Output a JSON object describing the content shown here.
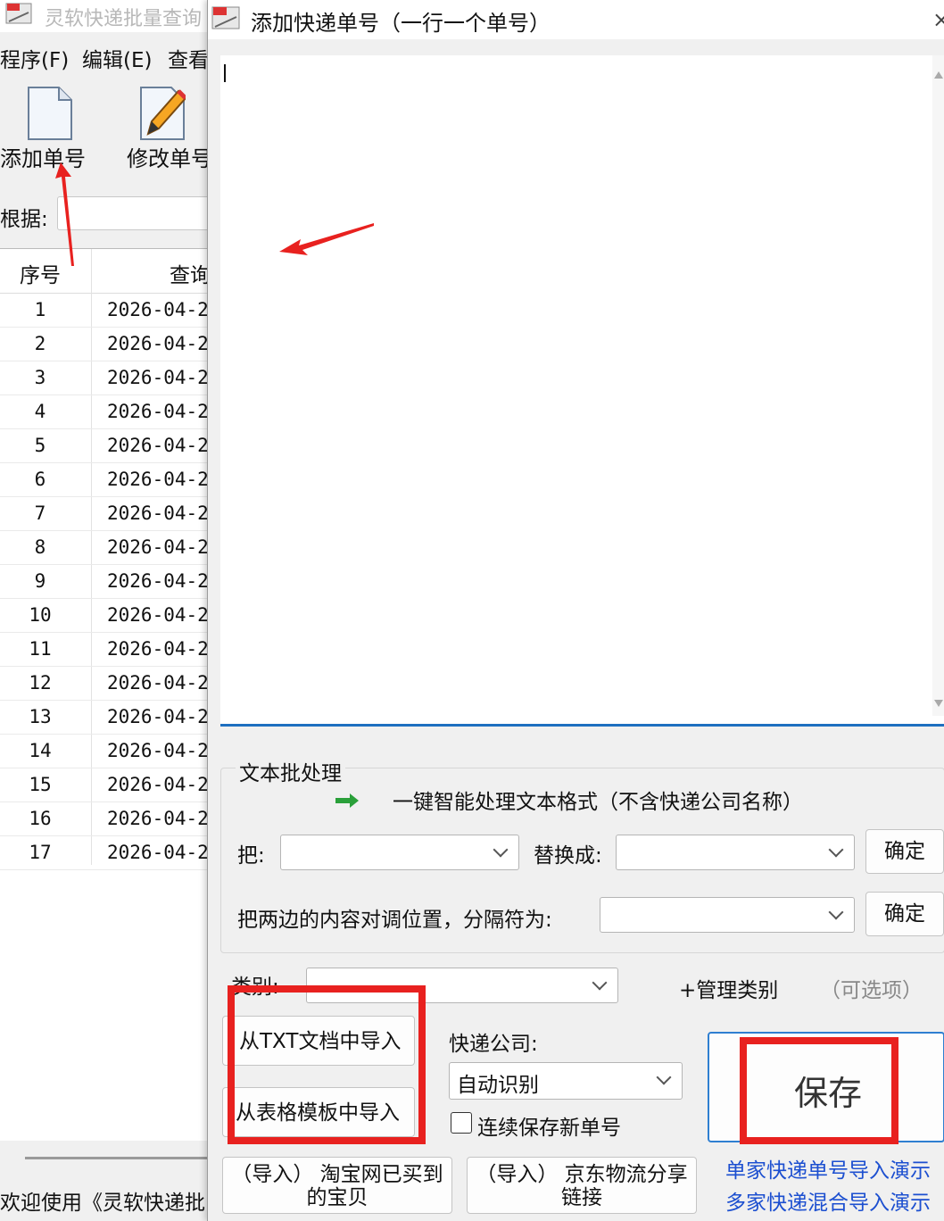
{
  "main_window": {
    "title": "灵软快递批量查询",
    "menu": [
      "程序(F)",
      "编辑(E)",
      "查看"
    ],
    "toolbar": {
      "add_label": "添加单号",
      "edit_label": "修改单号"
    },
    "basis_label": "根据:",
    "grid": {
      "headers": [
        "序号",
        "查询"
      ],
      "rows": [
        {
          "n": "1",
          "d": "2026-04-2"
        },
        {
          "n": "2",
          "d": "2026-04-2"
        },
        {
          "n": "3",
          "d": "2026-04-2"
        },
        {
          "n": "4",
          "d": "2026-04-2"
        },
        {
          "n": "5",
          "d": "2026-04-2"
        },
        {
          "n": "6",
          "d": "2026-04-2"
        },
        {
          "n": "7",
          "d": "2026-04-2"
        },
        {
          "n": "8",
          "d": "2026-04-2"
        },
        {
          "n": "9",
          "d": "2026-04-2"
        },
        {
          "n": "10",
          "d": "2026-04-2"
        },
        {
          "n": "11",
          "d": "2026-04-2"
        },
        {
          "n": "12",
          "d": "2026-04-2"
        },
        {
          "n": "13",
          "d": "2026-04-2"
        },
        {
          "n": "14",
          "d": "2026-04-2"
        },
        {
          "n": "15",
          "d": "2026-04-2"
        },
        {
          "n": "16",
          "d": "2026-04-2"
        },
        {
          "n": "17",
          "d": "2026-04-2"
        }
      ]
    },
    "status": "欢迎使用《灵软快递批"
  },
  "dialog": {
    "title": "添加快递单号（一行一个单号）",
    "close": "×",
    "editor_value": "",
    "batch": {
      "legend": "文本批处理",
      "smart_format": "一键智能处理文本格式（不含快递公司名称）",
      "replace_from_label": "把:",
      "replace_to_label": "替换成:",
      "confirm_1": "确定",
      "swap_label": "把两边的内容对调位置，分隔符为:",
      "confirm_2": "确定"
    },
    "category": {
      "label": "类别:",
      "manage": "+管理类别",
      "optional": "（可选项）"
    },
    "import_txt": "从TXT文档中导入",
    "import_sheet": "从表格模板中导入",
    "courier_label": "快递公司:",
    "courier_value": "自动识别",
    "continuous_save": "连续保存新单号",
    "save": "保存",
    "import_taobao": {
      "line1": "（导入）",
      "line2": "淘宝网已买到的宝贝"
    },
    "import_jd": {
      "line1": "（导入）",
      "line2": "京东物流分享链接"
    },
    "demo_single": "单家快递单号导入演示",
    "demo_multi": "多家快递混合导入演示"
  },
  "colors": {
    "accent": "#1e6fc0",
    "annotation_red": "#e8211f",
    "link": "#1c4fd0",
    "arrow_green": "#2aa03a"
  },
  "icons": [
    "app-icon",
    "document-icon",
    "pencil-edit-icon",
    "green-arrow-icon",
    "chevron-down-icon",
    "close-icon"
  ]
}
